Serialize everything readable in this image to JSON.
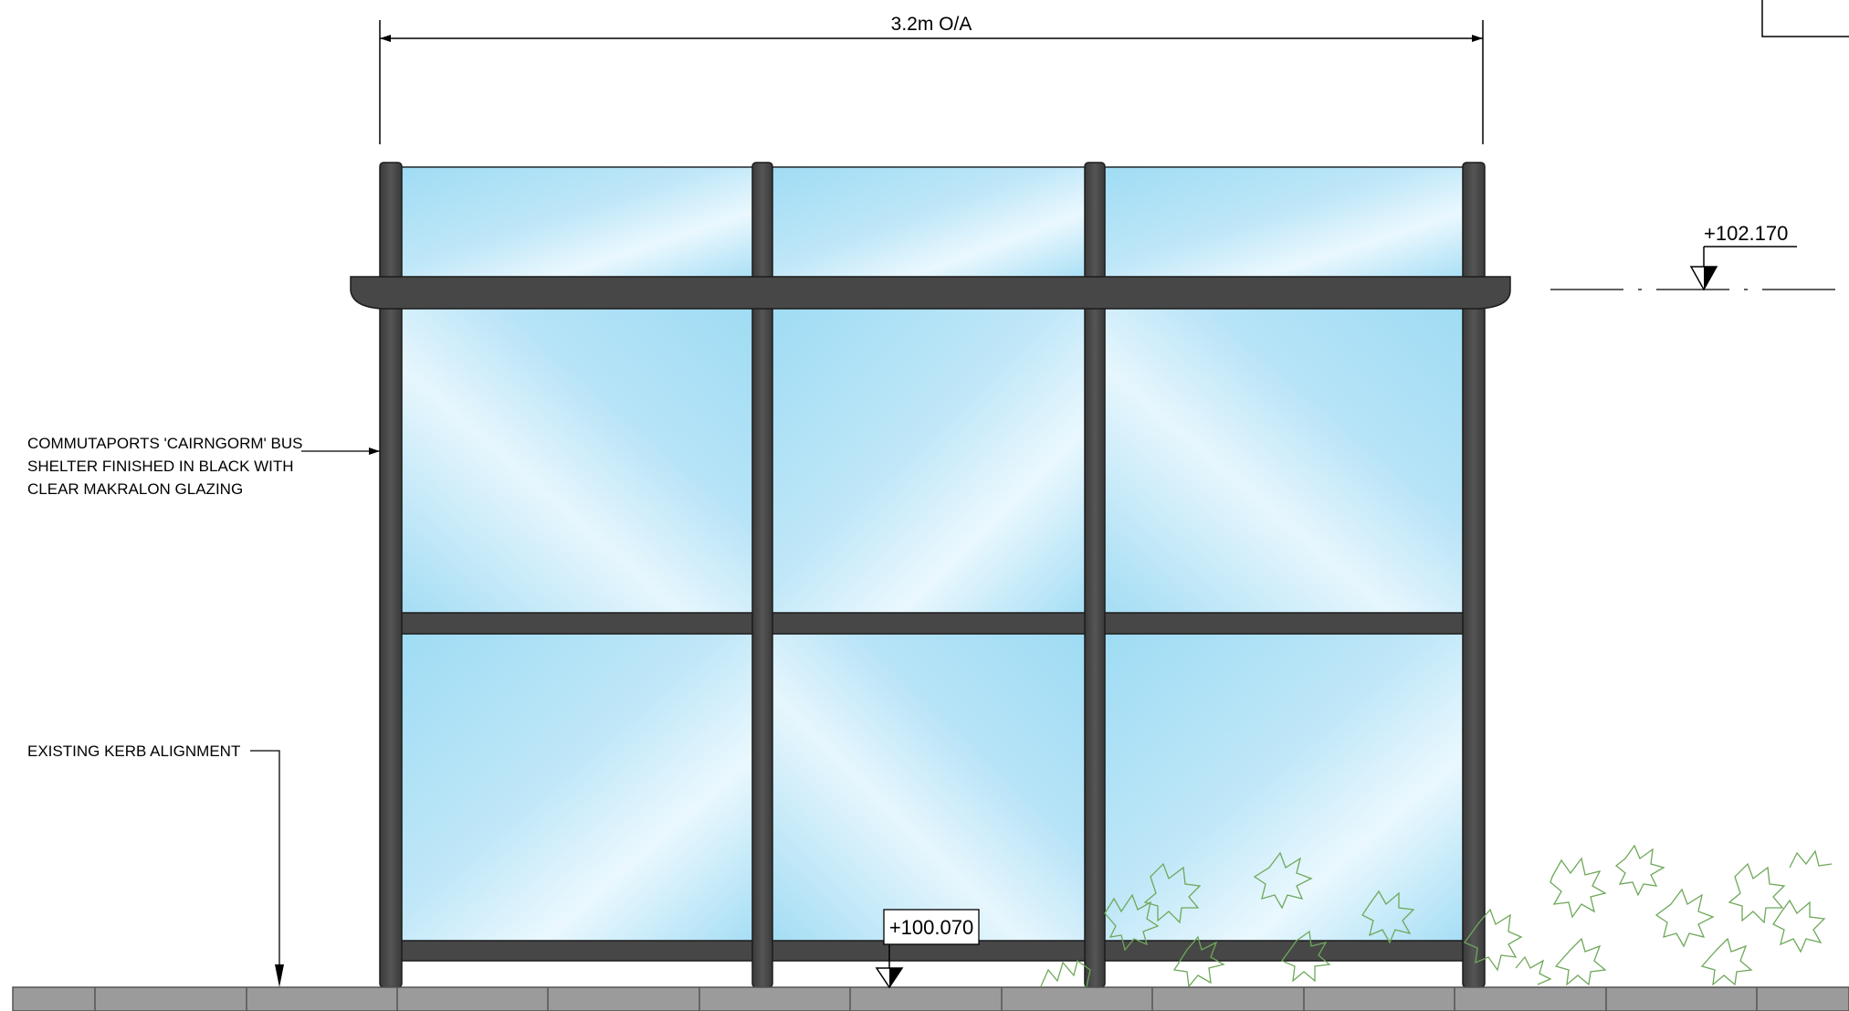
{
  "dimension": {
    "overall_label": "3.2m O/A"
  },
  "levels": {
    "roof": "+102.170",
    "ground": "+100.070"
  },
  "annotations": {
    "shelter_note": [
      "COMMUTAPORTS 'CAIRNGORM' BUS",
      "SHELTER FINISHED IN BLACK WITH",
      "CLEAR MAKRALON GLAZING"
    ],
    "kerb_note": "EXISTING KERB ALIGNMENT"
  },
  "colors": {
    "frame": "#4a4a4a",
    "frame_outline": "#1c1c1c",
    "glass_light": "#eaf8fe",
    "glass_mid": "#bfe7f8",
    "glass_dark": "#9fdcf4",
    "pavement": "#9b9b9b",
    "foliage": "#6fa85a"
  }
}
